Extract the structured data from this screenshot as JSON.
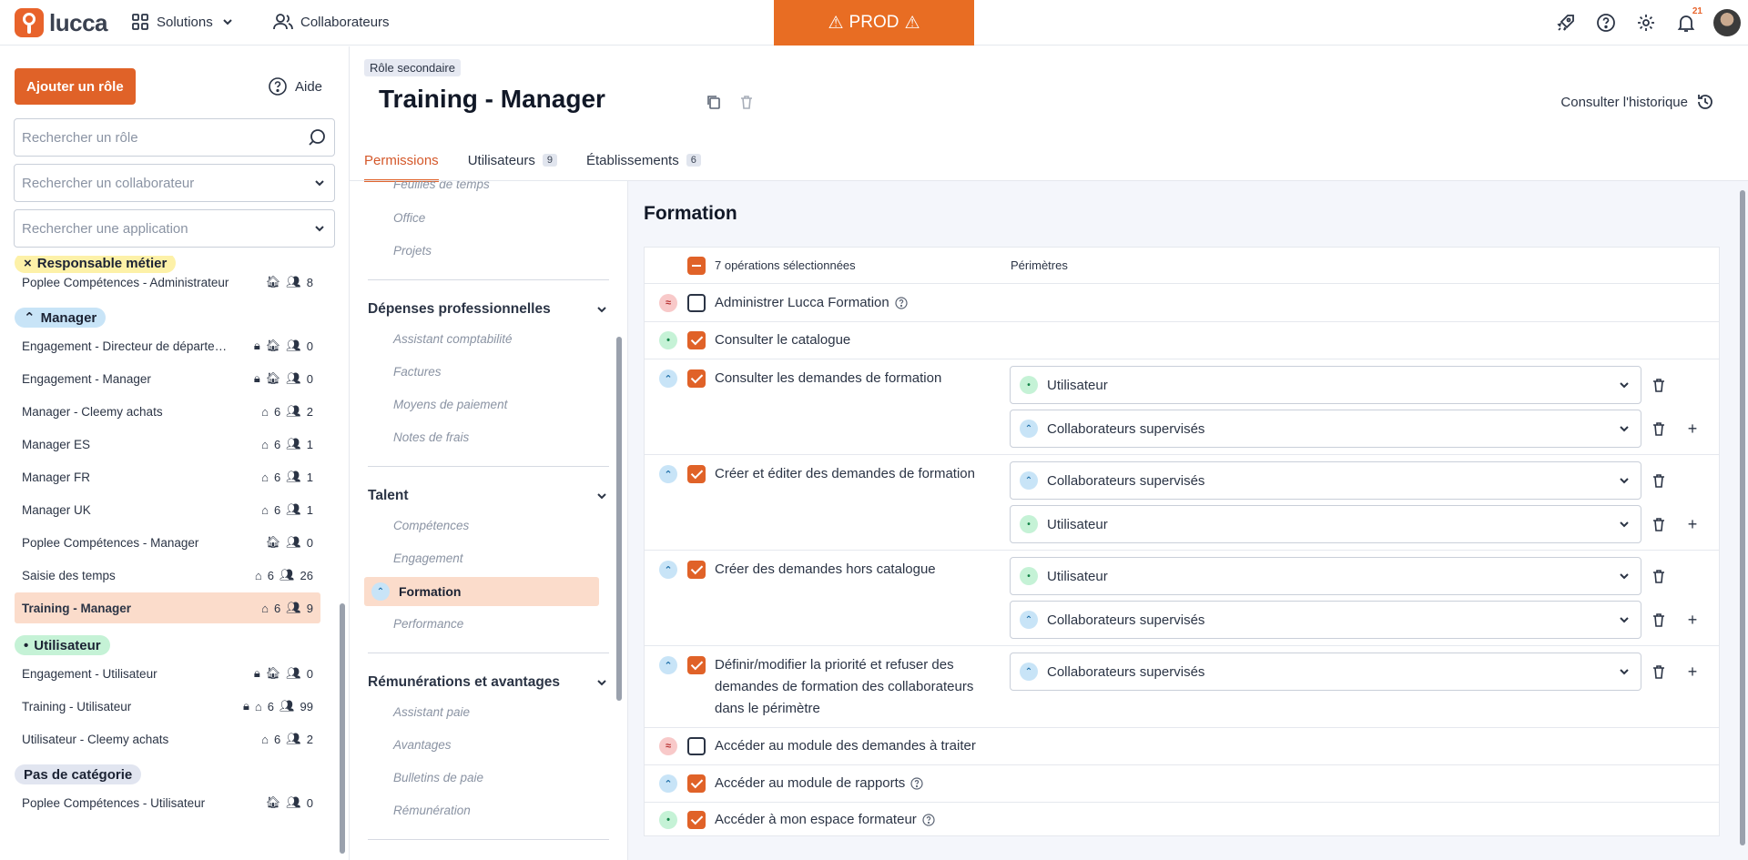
{
  "topbar": {
    "logo_text": "lucca",
    "nav": [
      {
        "label": "Solutions"
      },
      {
        "label": "Collaborateurs"
      }
    ],
    "prod_label": "PROD",
    "notifications_count": "21"
  },
  "sidebar": {
    "add_role_label": "Ajouter un rôle",
    "help_label": "Aide",
    "search_role_placeholder": "Rechercher un rôle",
    "search_user_placeholder": "Rechercher un collaborateur",
    "search_app_placeholder": "Rechercher une application",
    "categories": [
      {
        "label": "Responsable métier",
        "color": "#fdf1a8"
      },
      {
        "label": "Manager",
        "color": "#c8e4f7"
      },
      {
        "label": "Utilisateur",
        "color": "#c5f2d6"
      },
      {
        "label": "Pas de catégorie",
        "color": "#e1e5f0"
      }
    ],
    "roles": [
      {
        "name": "Poplee Compétences - Administrateur",
        "locked": false,
        "filled_home": true,
        "estab": "",
        "users": "8"
      },
      {
        "name": "Engagement - Directeur de départe…",
        "locked": true,
        "filled_home": true,
        "estab": "",
        "users": "0"
      },
      {
        "name": "Engagement - Manager",
        "locked": true,
        "filled_home": true,
        "estab": "",
        "users": "0"
      },
      {
        "name": "Manager - Cleemy achats",
        "locked": false,
        "filled_home": false,
        "estab": "6",
        "users": "2"
      },
      {
        "name": "Manager ES",
        "locked": false,
        "filled_home": false,
        "estab": "6",
        "users": "1"
      },
      {
        "name": "Manager FR",
        "locked": false,
        "filled_home": false,
        "estab": "6",
        "users": "1"
      },
      {
        "name": "Manager UK",
        "locked": false,
        "filled_home": false,
        "estab": "6",
        "users": "1"
      },
      {
        "name": "Poplee Compétences - Manager",
        "locked": false,
        "filled_home": true,
        "estab": "",
        "users": "0"
      },
      {
        "name": "Saisie des temps",
        "locked": false,
        "filled_home": false,
        "estab": "6",
        "users": "26"
      },
      {
        "name": "Training - Manager",
        "locked": false,
        "filled_home": false,
        "estab": "6",
        "users": "9"
      },
      {
        "name": "Engagement - Utilisateur",
        "locked": true,
        "filled_home": true,
        "estab": "",
        "users": "0"
      },
      {
        "name": "Training - Utilisateur",
        "locked": true,
        "filled_home": false,
        "estab": "6",
        "users": "99"
      },
      {
        "name": "Utilisateur - Cleemy achats",
        "locked": false,
        "filled_home": false,
        "estab": "6",
        "users": "2"
      },
      {
        "name": "Poplee Compétences - Utilisateur",
        "locked": false,
        "filled_home": true,
        "estab": "",
        "users": "0"
      }
    ]
  },
  "header": {
    "tag": "Rôle secondaire",
    "title": "Training - Manager",
    "history_label": "Consulter l'historique",
    "tabs": [
      {
        "label": "Permissions",
        "count": ""
      },
      {
        "label": "Utilisateurs",
        "count": "9"
      },
      {
        "label": "Établissements",
        "count": "6"
      }
    ]
  },
  "appnav": {
    "items": [
      "Feuilles de temps",
      "Office",
      "Projets",
      "Dépenses professionnelles",
      "Assistant comptabilité",
      "Factures",
      "Moyens de paiement",
      "Notes de frais",
      "Talent",
      "Compétences",
      "Engagement",
      "Formation",
      "Performance",
      "Rémunérations et avantages",
      "Assistant paie",
      "Avantages",
      "Bulletins de paie",
      "Rémunération"
    ]
  },
  "main": {
    "title": "Formation",
    "selected_ops": "7 opérations sélectionnées",
    "scopes_header": "Périmètres",
    "operations": [
      {
        "label": "Administrer Lucca Formation",
        "checked": false,
        "level": "red",
        "help": true
      },
      {
        "label": "Consulter le catalogue",
        "checked": true,
        "level": "green",
        "help": false
      },
      {
        "label": "Consulter les demandes de formation",
        "checked": true,
        "level": "blue",
        "help": false,
        "scopes": [
          {
            "label": "Utilisateur",
            "color": "green"
          },
          {
            "label": "Collaborateurs supervisés",
            "color": "blue"
          }
        ]
      },
      {
        "label": "Créer et éditer des demandes de formation",
        "checked": true,
        "level": "blue",
        "help": false,
        "scopes": [
          {
            "label": "Collaborateurs supervisés",
            "color": "blue"
          },
          {
            "label": "Utilisateur",
            "color": "green"
          }
        ]
      },
      {
        "label": "Créer des demandes hors catalogue",
        "checked": true,
        "level": "blue",
        "help": false,
        "scopes": [
          {
            "label": "Utilisateur",
            "color": "green"
          },
          {
            "label": "Collaborateurs supervisés",
            "color": "blue"
          }
        ]
      },
      {
        "label_lines": [
          "Définir/modifier la priorité et refuser des",
          "demandes de formation des collaborateurs",
          "dans le périmètre"
        ],
        "checked": true,
        "level": "blue",
        "help": false,
        "scopes": [
          {
            "label": "Collaborateurs supervisés",
            "color": "blue"
          }
        ]
      },
      {
        "label": "Accéder au module des demandes à traiter",
        "checked": false,
        "level": "red",
        "help": false
      },
      {
        "label": "Accéder au module de rapports",
        "checked": true,
        "level": "blue",
        "help": true
      },
      {
        "label": "Accéder à mon espace formateur",
        "checked": true,
        "level": "green",
        "help": true
      }
    ]
  }
}
